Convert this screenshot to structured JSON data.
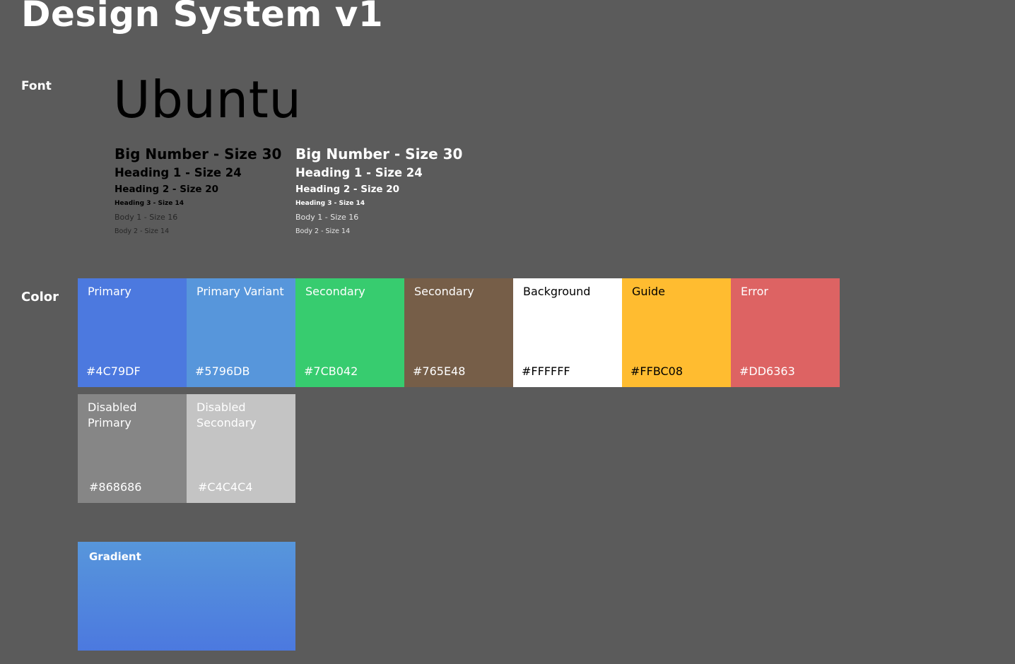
{
  "page": {
    "title": "Design System v1",
    "background": "#5B5B5B"
  },
  "font_section": {
    "label": "Font",
    "sample": "Ubuntu",
    "type_scale": [
      "Big Number - Size 30",
      "Heading 1 - Size 24",
      "Heading 2 - Size 20",
      "Heading 3 - Size 14",
      "Body 1 - Size 16",
      "Body 2 - Size 14"
    ]
  },
  "color_section": {
    "label": "Color",
    "swatches": [
      {
        "name": "Primary",
        "hex": "#4C79DF",
        "text_color": "#FFFFFF"
      },
      {
        "name": "Primary Variant",
        "hex": "#5796DB",
        "text_color": "#FFFFFF"
      },
      {
        "name": "Secondary",
        "hex": "#7CB042",
        "text_color": "#FFFFFF",
        "display_color": "#37CC6F"
      },
      {
        "name": "Secondary",
        "hex": "#765E48",
        "text_color": "#FFFFFF"
      },
      {
        "name": "Background",
        "hex": "#FFFFFF",
        "text_color": "#000000"
      },
      {
        "name": "Guide",
        "hex": "#FFBC08",
        "text_color": "#000000",
        "display_color": "#FFBC30"
      },
      {
        "name": "Error",
        "hex": "#DD6363",
        "text_color": "#FFFFFF"
      },
      {
        "name": "Disabled Primary",
        "hex": "#868686",
        "text_color": "#FFFFFF"
      },
      {
        "name": "Disabled Secondary",
        "hex": "#C4C4C4",
        "text_color": "#FFFFFF"
      }
    ],
    "gradient": {
      "label": "Gradient",
      "from": "#5796DB",
      "to": "#4C79DF"
    }
  }
}
